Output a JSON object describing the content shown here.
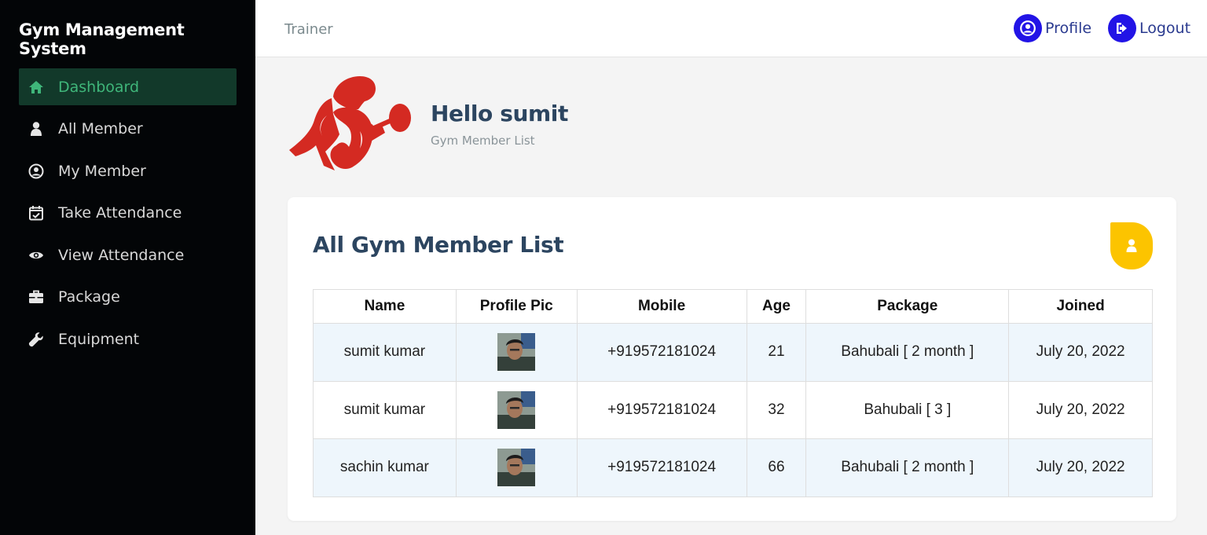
{
  "sidebar": {
    "brand": "Gym Management System",
    "items": [
      {
        "label": "Dashboard",
        "icon": "home-icon",
        "active": true
      },
      {
        "label": "All Member",
        "icon": "user-icon"
      },
      {
        "label": "My Member",
        "icon": "user-circle-icon"
      },
      {
        "label": "Take Attendance",
        "icon": "calendar-check-icon"
      },
      {
        "label": "View Attendance",
        "icon": "eye-icon"
      },
      {
        "label": "Package",
        "icon": "briefcase-icon"
      },
      {
        "label": "Equipment",
        "icon": "wrench-icon"
      }
    ]
  },
  "topbar": {
    "role": "Trainer",
    "profile_label": "Profile",
    "logout_label": "Logout"
  },
  "header": {
    "greeting": "Hello sumit",
    "subtitle": "Gym Member List"
  },
  "card": {
    "title": "All Gym Member List",
    "badge_icon": "user-icon"
  },
  "table": {
    "columns": [
      "Name",
      "Profile Pic",
      "Mobile",
      "Age",
      "Package",
      "Joined"
    ],
    "rows": [
      {
        "name": "sumit kumar",
        "mobile": "+919572181024",
        "age": "21",
        "package": "Bahubali [ 2 month ]",
        "joined": "July 20, 2022"
      },
      {
        "name": "sumit kumar",
        "mobile": "+919572181024",
        "age": "32",
        "package": "Bahubali [ 3 ]",
        "joined": "July 20, 2022"
      },
      {
        "name": "sachin kumar",
        "mobile": "+919572181024",
        "age": "66",
        "package": "Bahubali [ 2 month ]",
        "joined": "July 20, 2022"
      }
    ]
  },
  "colors": {
    "sidebar_bg": "#030507",
    "active_bg": "#12392a",
    "active_text": "#3fb67a",
    "accent_blue": "#2214e6",
    "logo_red": "#d42a22",
    "badge_yellow": "#fcc400",
    "heading": "#2c4560"
  }
}
